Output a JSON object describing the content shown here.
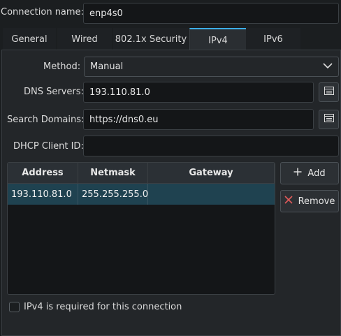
{
  "connection": {
    "label": "Connection name:",
    "value": "enp4s0"
  },
  "tabs": [
    {
      "label": "General"
    },
    {
      "label": "Wired"
    },
    {
      "label": "802.1x Security"
    },
    {
      "label": "IPv4"
    },
    {
      "label": "IPv6"
    }
  ],
  "active_tab": "IPv4",
  "form": {
    "method_label": "Method:",
    "method_value": "Manual",
    "dns_label": "DNS Servers:",
    "dns_value": "193.110.81.0",
    "search_label": "Search Domains:",
    "search_value": "https://dns0.eu",
    "dhcp_label": "DHCP Client ID:",
    "dhcp_value": ""
  },
  "table": {
    "columns": [
      "Address",
      "Netmask",
      "Gateway"
    ],
    "rows": [
      [
        "193.110.81.0",
        "255.255.255.0",
        ""
      ]
    ]
  },
  "buttons": {
    "add_label": "Add",
    "remove_label": "Remove"
  },
  "checkbox": {
    "label": "IPv4 is required for this connection",
    "checked": false
  },
  "colors": {
    "accent": "#3daee9",
    "selection": "#1f4250",
    "remove_icon": "#e05a5a"
  },
  "icons": [
    "chevron-down-icon",
    "edit-list-icon",
    "plus-icon",
    "close-icon"
  ]
}
